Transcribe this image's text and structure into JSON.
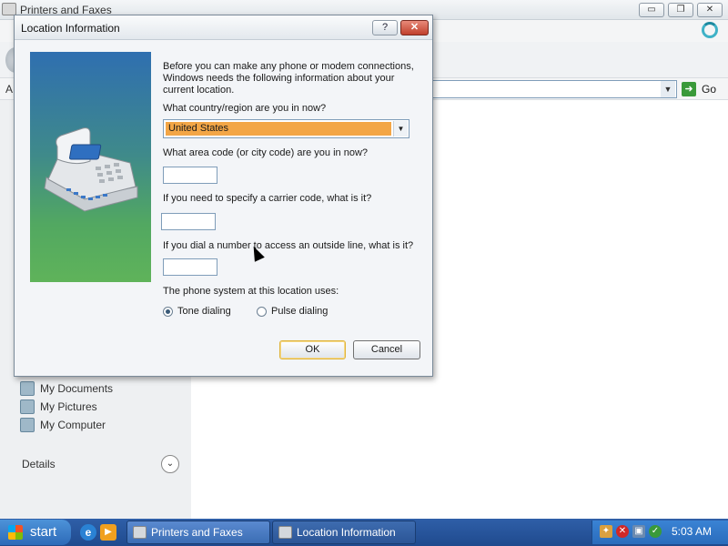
{
  "background_window": {
    "title": "Printers and Faxes",
    "title_buttons": {
      "minimize": "▭",
      "maximize": "❐",
      "close": "✕"
    },
    "address_label": "A",
    "go_label": "Go",
    "sidebar_items": [
      "My Documents",
      "My Pictures",
      "My Computer"
    ],
    "details_label": "Details"
  },
  "dialog": {
    "title": "Location Information",
    "help_button": "?",
    "close_button": "✕",
    "intro": "Before you can make any phone or modem connections, Windows needs the following information about your current location.",
    "country_question": "What country/region are you in now?",
    "country_value": "United States",
    "area_code_question": "What area code (or city code) are you in now?",
    "area_code_value": "",
    "carrier_question": "If you need to specify a carrier code, what is it?",
    "carrier_value": "",
    "outside_line_question": "If you dial a number to access an outside line, what is it?",
    "outside_line_value": "",
    "phone_system_question": "The phone system at this location uses:",
    "dialing_options": [
      {
        "label": "Tone dialing",
        "selected": true
      },
      {
        "label": "Pulse dialing",
        "selected": false
      }
    ],
    "ok_label": "OK",
    "cancel_label": "Cancel"
  },
  "taskbar": {
    "start_label": "start",
    "tasks": [
      "Printers and Faxes",
      "Location Information"
    ],
    "clock": "5:03 AM"
  },
  "colors": {
    "selection": "#f3a646",
    "taskbar": "#2f5fa8",
    "dialog_close": "#c0402c"
  }
}
